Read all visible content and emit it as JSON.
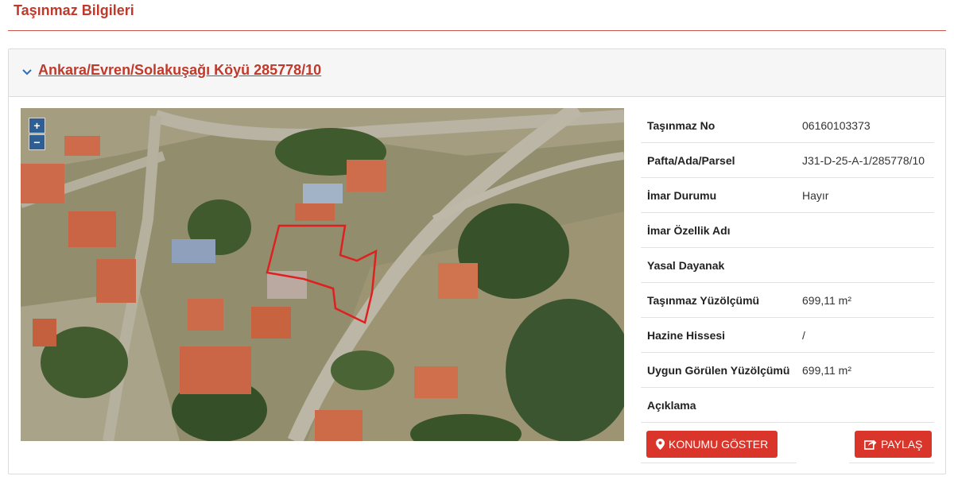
{
  "page": {
    "title": "Taşınmaz Bilgileri"
  },
  "panel": {
    "title": "Ankara/Evren/Solakuşağı Köyü 285778/10",
    "expand_icon": "chevron-down-icon"
  },
  "map": {
    "zoom_in": "+",
    "zoom_out": "−",
    "parcel_color": "#e02020"
  },
  "details": [
    {
      "key": "Taşınmaz No",
      "value": "06160103373"
    },
    {
      "key": "Pafta/Ada/Parsel",
      "value": "J31-D-25-A-1/285778/10"
    },
    {
      "key": "İmar Durumu",
      "value": "Hayır"
    },
    {
      "key": "İmar Özellik Adı",
      "value": ""
    },
    {
      "key": "Yasal Dayanak",
      "value": ""
    },
    {
      "key": "Taşınmaz Yüzölçümü",
      "value": "699,11 m²"
    },
    {
      "key": "Hazine Hissesi",
      "value": "/"
    },
    {
      "key": "Uygun Görülen Yüzölçümü",
      "value": "699,11 m²"
    },
    {
      "key": "Açıklama",
      "value": ""
    }
  ],
  "actions": {
    "show_location": "KONUMU GÖSTER",
    "show_location_icon": "map-marker-icon",
    "share": "PAYLAŞ",
    "share_icon": "share-icon"
  },
  "colors": {
    "accent": "#c0392b",
    "button": "#d9352a",
    "zoom": "#2f5f92"
  }
}
